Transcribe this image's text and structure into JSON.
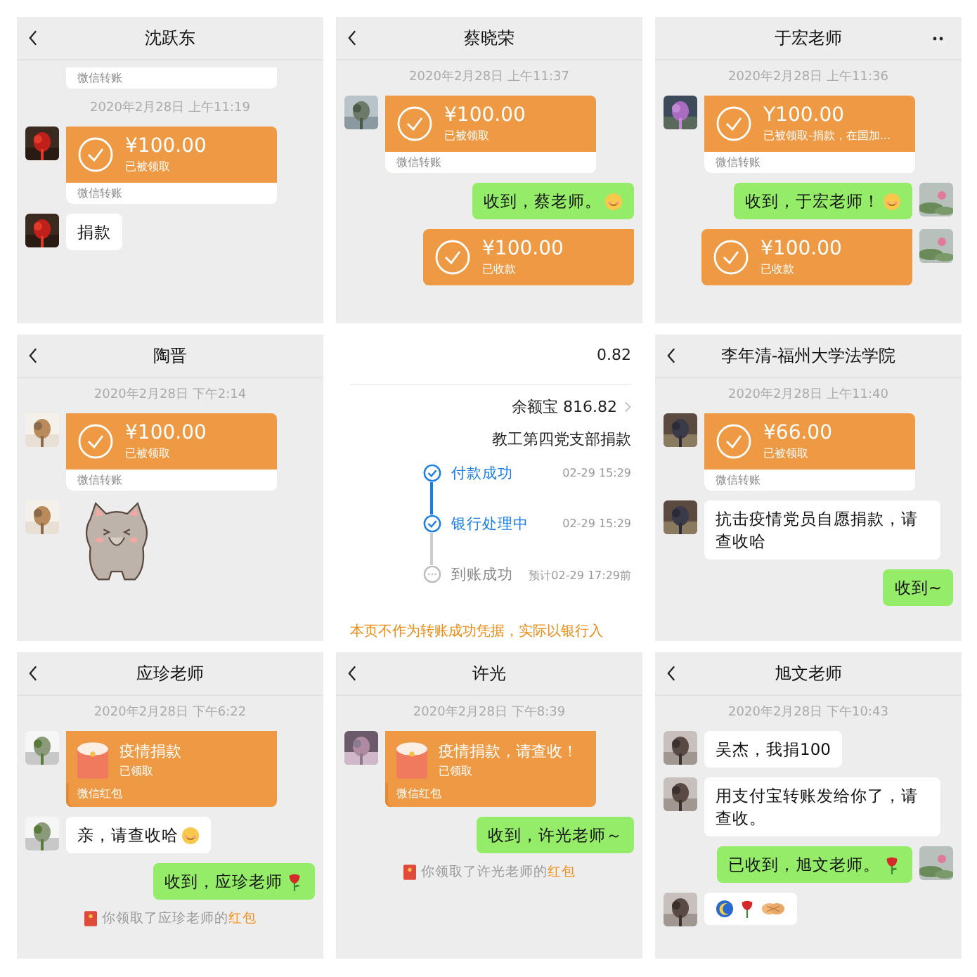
{
  "panels": [
    {
      "kind": "chat",
      "title": "沈跃东",
      "back": true,
      "more": false,
      "messages": [
        {
          "kind": "card_tail",
          "footer": "微信转账"
        },
        {
          "kind": "time",
          "text": "2020年2月28日 上午11:19"
        },
        {
          "kind": "transfer",
          "outgoing": false,
          "amount": "¥100.00",
          "status": "已被领取",
          "footer": "微信转账"
        },
        {
          "kind": "text",
          "outgoing": false,
          "text": "捐款"
        }
      ]
    },
    {
      "kind": "chat",
      "title": "蔡晓荣",
      "back": true,
      "more": false,
      "messages": [
        {
          "kind": "time",
          "text": "2020年2月28日 上午11:37"
        },
        {
          "kind": "transfer",
          "outgoing": false,
          "amount": "¥100.00",
          "status": "已被领取",
          "footer": "微信转账"
        },
        {
          "kind": "text",
          "outgoing": true,
          "text": "收到，蔡老师。",
          "emoji": {
            "kind": "smile"
          }
        },
        {
          "kind": "transfer",
          "outgoing": true,
          "amount": "¥100.00",
          "status": "已收款"
        }
      ]
    },
    {
      "kind": "chat",
      "title": "于宏老师",
      "back": false,
      "more": true,
      "self_avatar": true,
      "messages": [
        {
          "kind": "time",
          "text": "2020年2月28日 上午11:36"
        },
        {
          "kind": "transfer",
          "outgoing": false,
          "amount": "Y100.00",
          "status": "已被领取-捐款，在国加...",
          "footer": "微信转账"
        },
        {
          "kind": "text",
          "outgoing": true,
          "text": "收到，于宏老师！",
          "emoji": {
            "kind": "smile"
          }
        },
        {
          "kind": "transfer",
          "outgoing": true,
          "amount": "¥100.00",
          "status": "已收款"
        }
      ]
    },
    {
      "kind": "chat",
      "title": "陶晋",
      "back": true,
      "more": false,
      "messages": [
        {
          "kind": "time",
          "text": "2020年2月28日 下午2:14"
        },
        {
          "kind": "transfer",
          "outgoing": false,
          "amount": "¥100.00",
          "status": "已被领取",
          "footer": "微信转账"
        },
        {
          "kind": "sticker"
        }
      ]
    },
    {
      "kind": "transfer_detail",
      "amount_tail": "0.82",
      "balance": "余额宝 816.82",
      "memo": "教工第四党支部捐款",
      "steps": [
        {
          "label": "付款成功",
          "time": "02-29 15:29",
          "done": true
        },
        {
          "label": "银行处理中",
          "time": "02-29 15:29",
          "done": true
        },
        {
          "label": "到账成功",
          "time": "预计02-29 17:29前",
          "done": false
        }
      ],
      "notice": "本页不作为转账成功凭据，实际以银行入"
    },
    {
      "kind": "chat",
      "title": "李年清-福州大学法学院",
      "back": true,
      "more": false,
      "messages": [
        {
          "kind": "time",
          "text": "2020年2月28日 上午11:40"
        },
        {
          "kind": "transfer",
          "outgoing": false,
          "amount": "¥66.00",
          "status": "已被领取",
          "footer": "微信转账"
        },
        {
          "kind": "text",
          "outgoing": false,
          "text": "抗击疫情党员自愿捐款，请查收哈"
        },
        {
          "kind": "text",
          "outgoing": true,
          "text": "收到~"
        }
      ]
    },
    {
      "kind": "chat",
      "title": "应珍老师",
      "back": true,
      "more": false,
      "messages": [
        {
          "kind": "time",
          "text": "2020年2月28日 下午6:22"
        },
        {
          "kind": "redpacket",
          "outgoing": false,
          "title": "疫情捐款",
          "status": "已领取",
          "footer": "微信红包"
        },
        {
          "kind": "text",
          "outgoing": false,
          "text": "亲，请查收哈",
          "emoji": {
            "kind": "smile"
          }
        },
        {
          "kind": "text",
          "outgoing": true,
          "text": "收到，应珍老师",
          "emoji": {
            "kind": "rose"
          }
        },
        {
          "kind": "notice",
          "text": "你领取了应珍老师的",
          "link": "红包"
        }
      ]
    },
    {
      "kind": "chat",
      "title": "许光",
      "back": true,
      "more": false,
      "messages": [
        {
          "kind": "time",
          "text": "2020年2月28日 下午8:39"
        },
        {
          "kind": "redpacket",
          "outgoing": false,
          "title": "疫情捐款，请查收！",
          "status": "已领取",
          "footer": "微信红包"
        },
        {
          "kind": "text",
          "outgoing": true,
          "text": "收到，许光老师～"
        },
        {
          "kind": "notice",
          "text": "你领取了许光老师的",
          "link": "红包"
        }
      ]
    },
    {
      "kind": "chat",
      "title": "旭文老师",
      "back": true,
      "more": false,
      "self_avatar": true,
      "messages": [
        {
          "kind": "time",
          "text": "2020年2月28日 下午10:43"
        },
        {
          "kind": "text",
          "outgoing": false,
          "text": "吴杰，我捐100"
        },
        {
          "kind": "text",
          "outgoing": false,
          "text": "用支付宝转账发给你了，请查收。"
        },
        {
          "kind": "text",
          "outgoing": true,
          "text": "已收到，旭文老师。",
          "emoji": {
            "kind": "rose"
          }
        },
        {
          "kind": "icons",
          "outgoing": false
        }
      ]
    }
  ]
}
